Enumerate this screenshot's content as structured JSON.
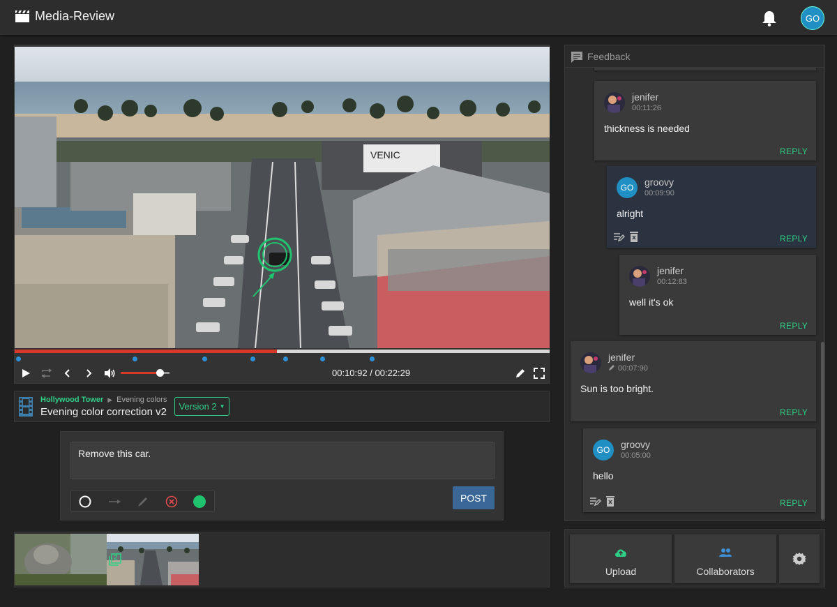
{
  "app": {
    "title": "Media-Review",
    "user_initials": "GO"
  },
  "player": {
    "current_time": "00:10:92",
    "duration": "00:22:29",
    "progress_fraction": 0.49,
    "volume_fraction": 0.8,
    "marker_count": 7
  },
  "asset": {
    "project": "Hollywood Tower",
    "folder": "Evening colors",
    "title": "Evening color correction v2",
    "version_label": "Version 2"
  },
  "composer": {
    "text": "Remove this car.",
    "post_label": "POST"
  },
  "feedback": {
    "header": "Feedback",
    "reply_label": "REPLY",
    "comments": [
      {
        "author": "jenifer",
        "time": "00:11:26",
        "text": "thickness is needed",
        "avatar": "photo"
      },
      {
        "author": "groovy",
        "time": "00:09:90",
        "text": "alright",
        "avatar": "GO"
      },
      {
        "author": "jenifer",
        "time": "00:12:83",
        "text": "well it's ok",
        "avatar": "photo"
      },
      {
        "author": "jenifer",
        "time": "00:07:90",
        "text": "Sun is too bright.",
        "avatar": "photo"
      },
      {
        "author": "groovy",
        "time": "00:05:00",
        "text": "hello",
        "avatar": "GO"
      }
    ]
  },
  "thumbnails": {
    "badge_number": "2"
  },
  "actions": {
    "upload_label": "Upload",
    "collaborators_label": "Collaborators"
  },
  "colors": {
    "accent_green": "#2fcf86",
    "progress_red": "#d8382a",
    "marker_blue": "#2d8fd6",
    "post_blue": "#3a6795",
    "avatar_blue": "#1f8fc4"
  },
  "icons": [
    "clapperboard-icon",
    "bell-icon",
    "play-icon",
    "loop-icon",
    "prev-frame-icon",
    "next-frame-icon",
    "volume-icon",
    "pencil-icon",
    "fullscreen-icon",
    "film-icon",
    "circle-tool-icon",
    "arrow-tool-icon",
    "brush-tool-icon",
    "clear-icon",
    "color-swatch-icon",
    "comment-icon",
    "edit-icon",
    "delete-icon",
    "cloud-upload-icon",
    "people-icon",
    "gear-icon"
  ]
}
